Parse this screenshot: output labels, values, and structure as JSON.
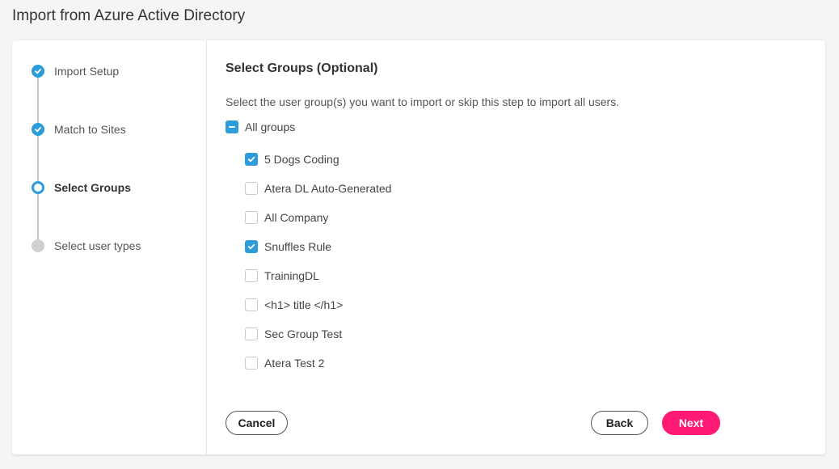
{
  "page": {
    "title": "Import from Azure Active Directory"
  },
  "colors": {
    "accent": "#2d9cdb",
    "primary_button": "#ff1a75",
    "pending_step": "#d0d0d0"
  },
  "steps": [
    {
      "label": "Import Setup",
      "status": "done"
    },
    {
      "label": "Match to Sites",
      "status": "done"
    },
    {
      "label": "Select Groups",
      "status": "current"
    },
    {
      "label": "Select user types",
      "status": "pending"
    }
  ],
  "content": {
    "title": "Select Groups (Optional)",
    "description": "Select the user group(s) you want to import or skip this step to import all users.",
    "all_groups": {
      "label": "All groups",
      "state": "indeterminate"
    },
    "groups": [
      {
        "label": "5 Dogs Coding",
        "checked": true
      },
      {
        "label": "Atera DL Auto-Generated",
        "checked": false
      },
      {
        "label": "All Company",
        "checked": false
      },
      {
        "label": "Snuffles Rule",
        "checked": true
      },
      {
        "label": "TrainingDL",
        "checked": false
      },
      {
        "label": "<h1> title </h1>",
        "checked": false
      },
      {
        "label": "Sec Group Test",
        "checked": false
      },
      {
        "label": "Atera Test 2",
        "checked": false
      }
    ]
  },
  "buttons": {
    "cancel": "Cancel",
    "back": "Back",
    "next": "Next"
  }
}
